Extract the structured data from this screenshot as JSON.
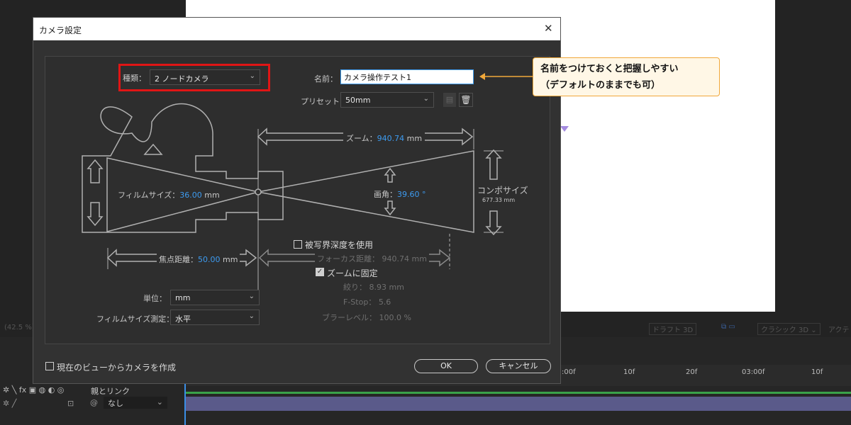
{
  "dialog": {
    "title": "カメラ設定",
    "close_glyph": "✕",
    "type_label": "種類：",
    "type_value": "2 ノードカメラ",
    "name_label": "名前：",
    "name_value": "カメラ操作テスト1",
    "preset_label": "プリセット：",
    "preset_value": "50mm",
    "zoom_label": "ズーム：",
    "zoom_value": "940.74",
    "zoom_unit": "mm",
    "film_size_label": "フィルムサイズ：",
    "film_size_value": "36.00",
    "film_size_unit": "mm",
    "angle_label": "画角：",
    "angle_value": "39.60",
    "angle_unit": "°",
    "comp_size_label": "コンポサイズ",
    "comp_size_value": "677.33 mm",
    "focal_label": "焦点距離：",
    "focal_value": "50.00",
    "focal_unit": "mm",
    "dof_label": "被写界深度を使用",
    "focus_dist_label": "フォーカス距離：",
    "focus_dist_value": "940.74 mm",
    "lock_zoom_label": "ズームに固定",
    "aperture_label": "絞り：",
    "aperture_value": "8.93 mm",
    "fstop_label": "F-Stop：",
    "fstop_value": "5.6",
    "blur_label": "ブラーレベル：",
    "blur_value": "100.0 %",
    "units_label": "単位：",
    "units_value": "mm",
    "measure_label": "フィルムサイズ測定：",
    "measure_value": "水平",
    "create_from_view_label": "現在のビューからカメラを作成",
    "ok_label": "OK",
    "cancel_label": "キャンセル"
  },
  "callout": {
    "line1": "名前をつけておくと把握しやすい",
    "line2": "（デフォルトのままでも可）"
  },
  "viewer_bar": {
    "zoom_text": "(42.5 %)",
    "draft_label": "ドラフト 3D",
    "renderer_label": "クラシック 3D",
    "active_label": "アクテ"
  },
  "timeline": {
    "ruler_labels": [
      ":00f",
      "10f",
      "20f",
      "03:00f",
      "10f"
    ],
    "parent_header": "親とリンク",
    "parent_value": "なし"
  },
  "colors": {
    "highlight_red": "#e01515",
    "callout_border": "#f1a83a",
    "accent_blue": "#3d9bf0"
  }
}
